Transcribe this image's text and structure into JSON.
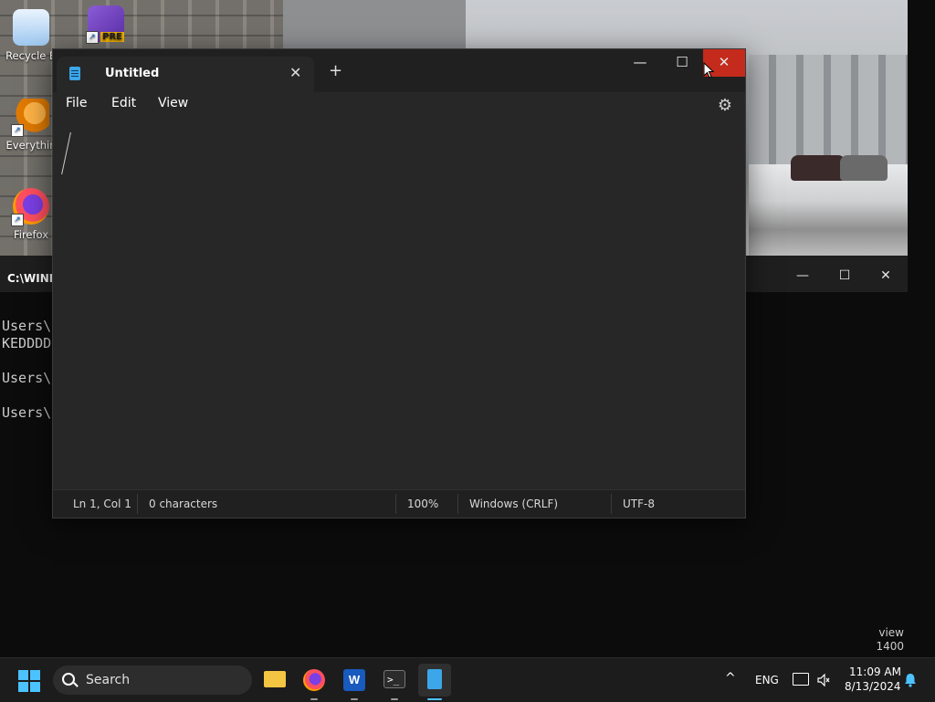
{
  "desktop": {
    "icons": [
      {
        "label": "Recycle Bin",
        "visible_label": "Recycle B",
        "icon": "recycle-bin-icon"
      },
      {
        "label": "PRE",
        "icon": "visual-studio-preview-icon"
      },
      {
        "label": "Everything",
        "visible_label": "Everythin",
        "icon": "everything-search-icon"
      },
      {
        "label": "Firefox",
        "icon": "firefox-icon"
      }
    ]
  },
  "terminal": {
    "title": "C:\\WIND",
    "lines": [
      "Users\\",
      "KEDDDDD",
      "Users\\",
      "Users\\"
    ],
    "side_text": [
      "view",
      "1400"
    ],
    "controls": {
      "minimize": "—",
      "maximize": "☐",
      "close": "✕"
    }
  },
  "notepad": {
    "tab": {
      "title": "Untitled",
      "close": "✕"
    },
    "new_tab": "+",
    "window_controls": {
      "minimize": "—",
      "maximize": "☐",
      "close": "✕"
    },
    "menu": {
      "file": "File",
      "edit": "Edit",
      "view": "View"
    },
    "settings_icon": "⚙",
    "status": {
      "position": "Ln 1, Col 1",
      "characters": "0 characters",
      "zoom": "100%",
      "line_ending": "Windows (CRLF)",
      "encoding": "UTF-8"
    }
  },
  "taskbar": {
    "search_placeholder": "Search",
    "apps": [
      {
        "name": "file-explorer",
        "running": false
      },
      {
        "name": "firefox",
        "running": true
      },
      {
        "name": "word",
        "running": true
      },
      {
        "name": "terminal",
        "running": true
      },
      {
        "name": "notepad",
        "running": true,
        "active": true
      }
    ],
    "tray": {
      "chevron": "^",
      "language": "ENG",
      "time": "11:09 AM",
      "date": "8/13/2024"
    }
  },
  "colors": {
    "accent": "#4cc2ff",
    "close_red": "#c42b1c",
    "notepad_bg": "#272727"
  }
}
